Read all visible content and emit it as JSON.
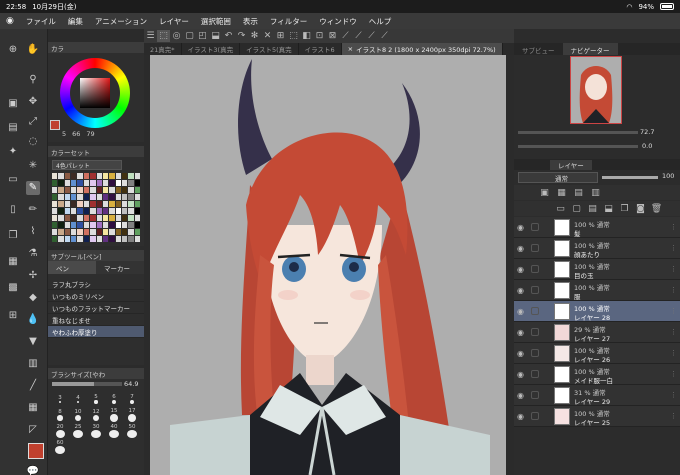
{
  "status_bar": {
    "time": "22:58",
    "date": "10月29日(金)",
    "battery": "94%"
  },
  "menu": [
    "ファイル",
    "編集",
    "アニメーション",
    "レイヤー",
    "選択範囲",
    "表示",
    "フィルター",
    "ウィンドウ",
    "ヘルプ"
  ],
  "color_panel": {
    "title": "カラ",
    "values": [
      "5",
      "66",
      "79"
    ]
  },
  "swatch_panel": {
    "title": "カラーセット",
    "dropdown": "4色パレット"
  },
  "subtool_panel": {
    "title": "サブツール[ペン]",
    "tab_pen": "ペン",
    "tab_marker": "マーカー",
    "items": [
      "ラフ丸ブラシ",
      "いつものミリペン",
      "いつものフラットマーカー",
      "重ねなじませ",
      "やわふわ厚塗り"
    ],
    "selected_index": 4
  },
  "brush_size_panel": {
    "title": "ブラシサイズ[やわ",
    "value": "64.9",
    "sizes": [
      "3",
      "4",
      "5",
      "6",
      "7",
      "8",
      "10",
      "12",
      "15",
      "17",
      "20",
      "25",
      "30",
      "40",
      "50",
      "60"
    ]
  },
  "tabs": [
    "21真完*",
    "イラスト3(真完",
    "イラスト5(真完",
    "イラスト6",
    "イラスト8 2 (1800 x 2400px 350dpi 72.7%)"
  ],
  "tab_active": 4,
  "navigator": {
    "tab1": "サブビュー",
    "tab2": "ナビゲーター",
    "zoom": "72.7",
    "rotation": "0.0"
  },
  "layer_panel": {
    "title": "レイヤー",
    "blend_mode": "通常",
    "opacity": "100"
  },
  "layers": [
    {
      "opacity": "100 %",
      "mode": "通常",
      "name": "髪",
      "selected": false,
      "thumb": "#fff"
    },
    {
      "opacity": "100 %",
      "mode": "通常",
      "name": "顔あたり",
      "selected": false,
      "thumb": "#fff"
    },
    {
      "opacity": "100 %",
      "mode": "通常",
      "name": "目の玉",
      "selected": false,
      "thumb": "#fff"
    },
    {
      "opacity": "100 %",
      "mode": "通常",
      "name": "服",
      "selected": false,
      "thumb": "#fff"
    },
    {
      "opacity": "100 %",
      "mode": "通常",
      "name": "レイヤー 28",
      "selected": true,
      "thumb": "#fff"
    },
    {
      "opacity": "29 %",
      "mode": "通常",
      "name": "レイヤー 27",
      "selected": false,
      "thumb": "#f2d8d8"
    },
    {
      "opacity": "100 %",
      "mode": "通常",
      "name": "レイヤー 26",
      "selected": false,
      "thumb": "#f4e8e6"
    },
    {
      "opacity": "100 %",
      "mode": "通常",
      "name": "メイド服一白",
      "selected": false,
      "thumb": "#fff"
    },
    {
      "opacity": "31 %",
      "mode": "通常",
      "name": "レイヤー 29",
      "selected": false,
      "thumb": "#fff"
    },
    {
      "opacity": "100 %",
      "mode": "通常",
      "name": "レイヤー 25",
      "selected": false,
      "thumb": "#f6e2e2"
    }
  ],
  "colors": {
    "accent": "#5a6680",
    "foreground": "#c0402e",
    "canvas_bg": "#aeaeae"
  }
}
